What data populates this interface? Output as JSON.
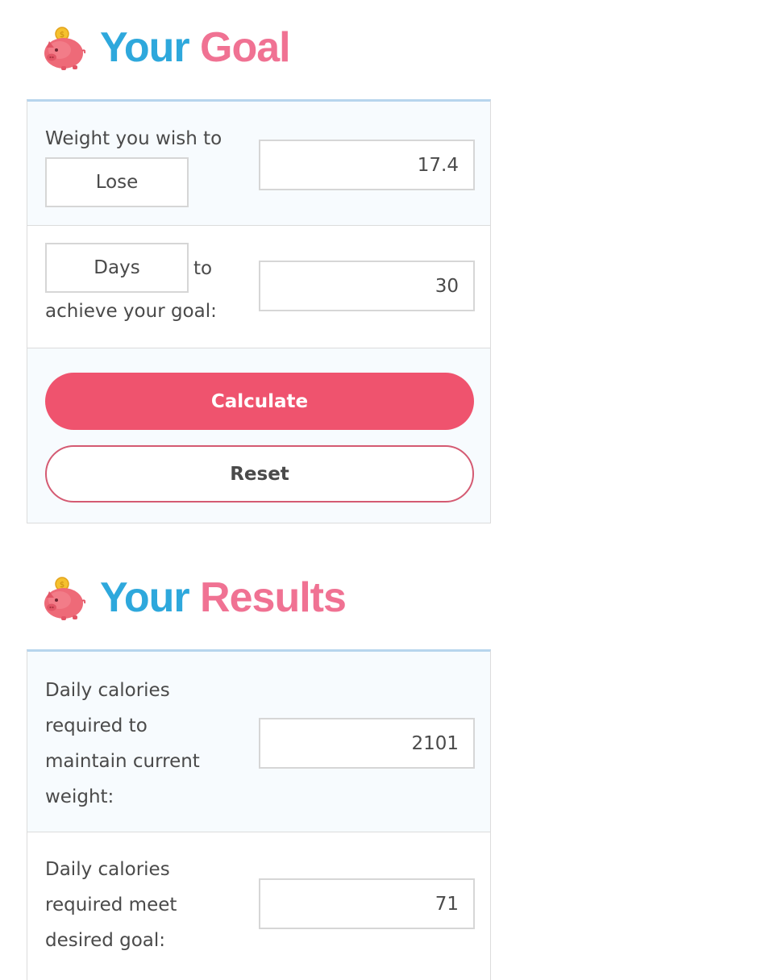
{
  "goal_section": {
    "title_word1": "Your",
    "title_word2": "Goal",
    "icon": "piggy-bank-icon"
  },
  "weight_row": {
    "label": "Weight you wish to",
    "mode_selected": "Lose",
    "value": "17.4"
  },
  "days_row": {
    "unit_selected": "Days",
    "label_to": "to",
    "label_goal": "achieve your goal:",
    "value": "30"
  },
  "buttons": {
    "calculate": "Calculate",
    "reset": "Reset"
  },
  "results_section": {
    "title_word1": "Your",
    "title_word2": "Results",
    "icon": "piggy-bank-icon"
  },
  "results": [
    {
      "label_lines": [
        "Daily calories",
        "required to",
        "maintain current",
        "weight:"
      ],
      "value": "2101"
    },
    {
      "label_lines": [
        "Daily calories",
        "required meet",
        "desired goal:"
      ],
      "value": "71"
    }
  ],
  "colors": {
    "title_blue": "#2ea8dc",
    "title_pink": "#f07293",
    "primary_button": "#ef536e",
    "panel_border_top": "#b7d5ed",
    "panel_background": "#f7fbfe"
  }
}
